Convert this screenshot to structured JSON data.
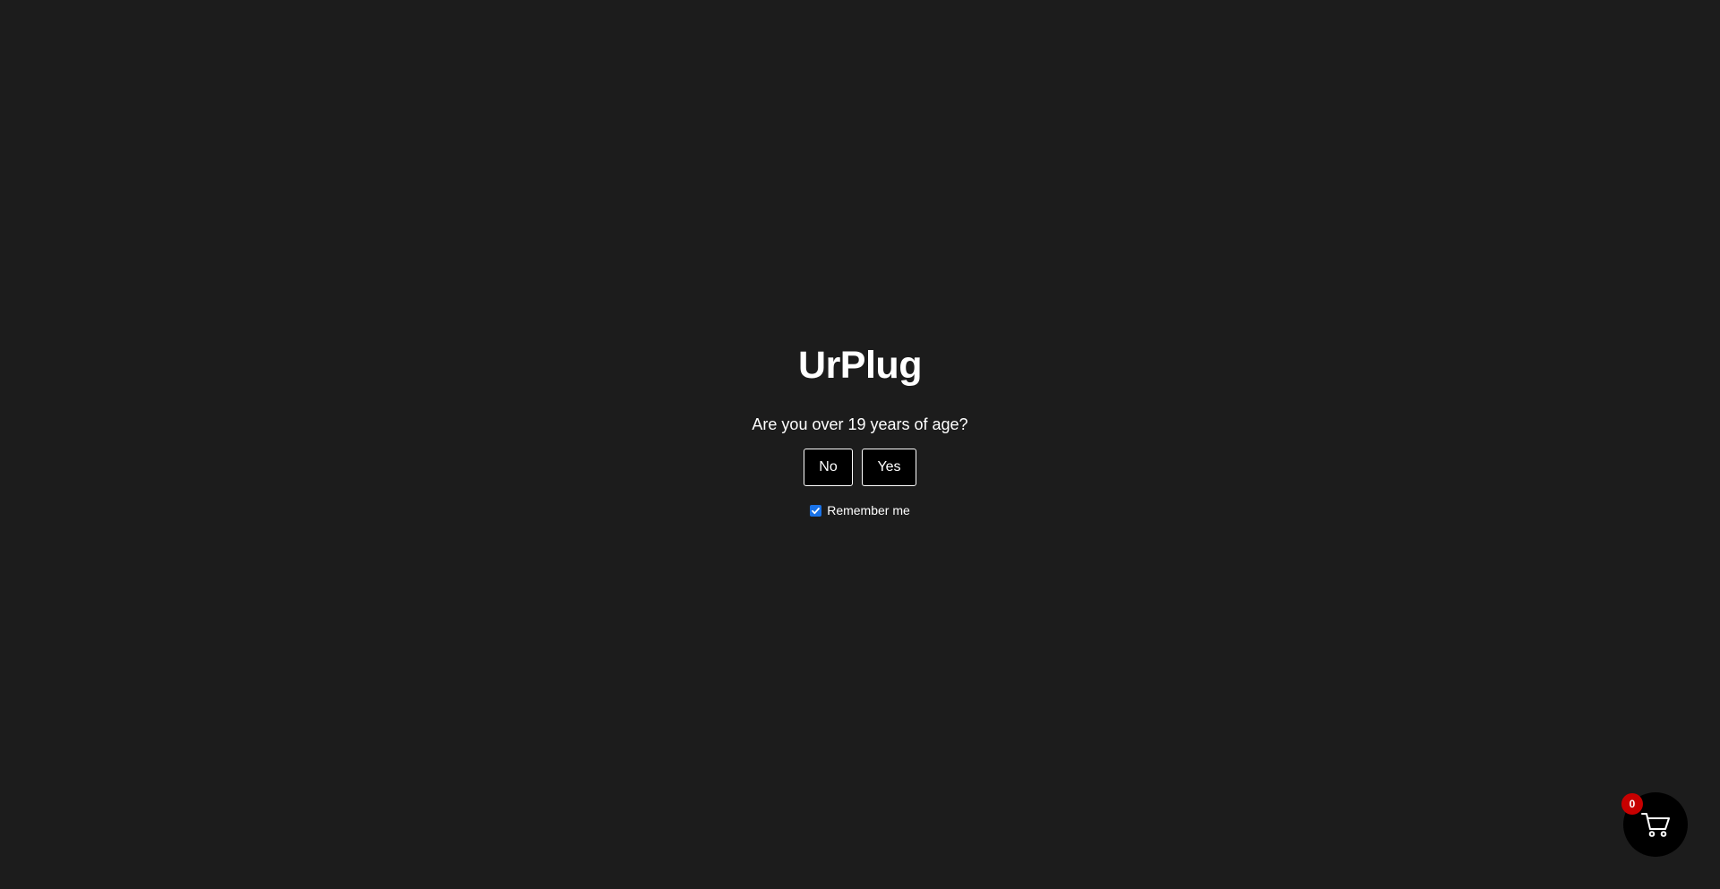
{
  "age_gate": {
    "brand": "UrPlug",
    "question": "Are you over 19 years of age?",
    "no_label": "No",
    "yes_label": "Yes",
    "remember_label": "Remember me",
    "remember_checked": true
  },
  "cart": {
    "count": "0",
    "icon": "cart-icon",
    "badge_color": "#c70000"
  },
  "colors": {
    "background": "#1c1c1c",
    "button_bg": "#000000",
    "checkbox_accent": "#1a73e8"
  }
}
